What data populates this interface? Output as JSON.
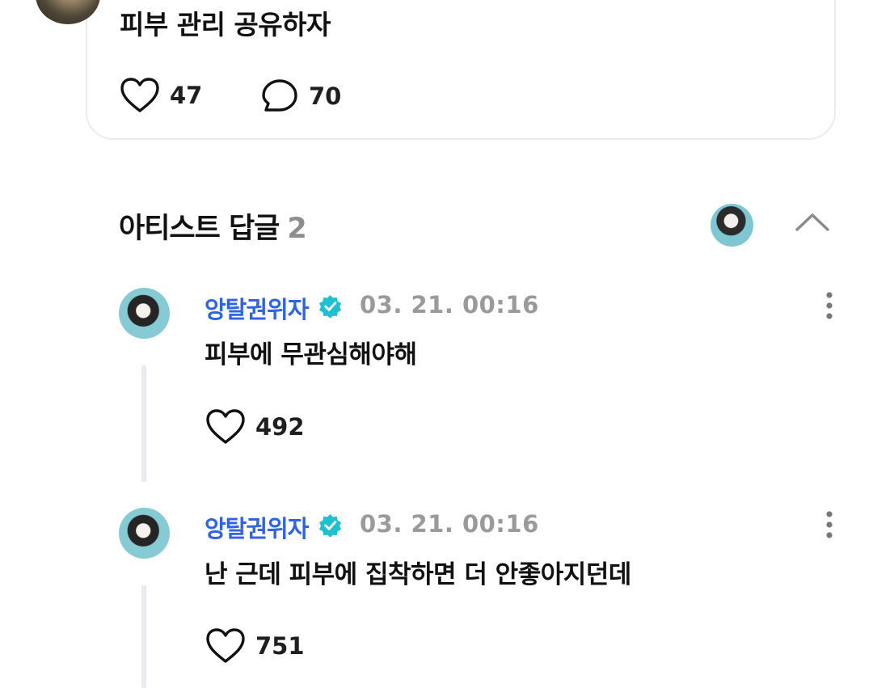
{
  "post": {
    "text": "피부 관리 공유하자",
    "likes": "47",
    "comments": "70"
  },
  "artist_replies": {
    "title": "아티스트 답글",
    "count": "2"
  },
  "replies": [
    {
      "author": "앙탈권위자",
      "timestamp": "03. 21. 00:16",
      "text": "피부에 무관심해야해",
      "likes": "492"
    },
    {
      "author": "앙탈권위자",
      "timestamp": "03. 21. 00:16",
      "text": "난 근데 피부에 집착하면 더 안좋아지던데",
      "likes": "751"
    }
  ],
  "colors": {
    "author_blue": "#2f63e6",
    "verified_teal": "#1fc1d1",
    "muted_gray": "#9a9a9a"
  },
  "icons": [
    "heart-icon",
    "comment-bubble-icon",
    "chevron-up-icon",
    "verified-badge-icon",
    "more-vertical-icon"
  ]
}
